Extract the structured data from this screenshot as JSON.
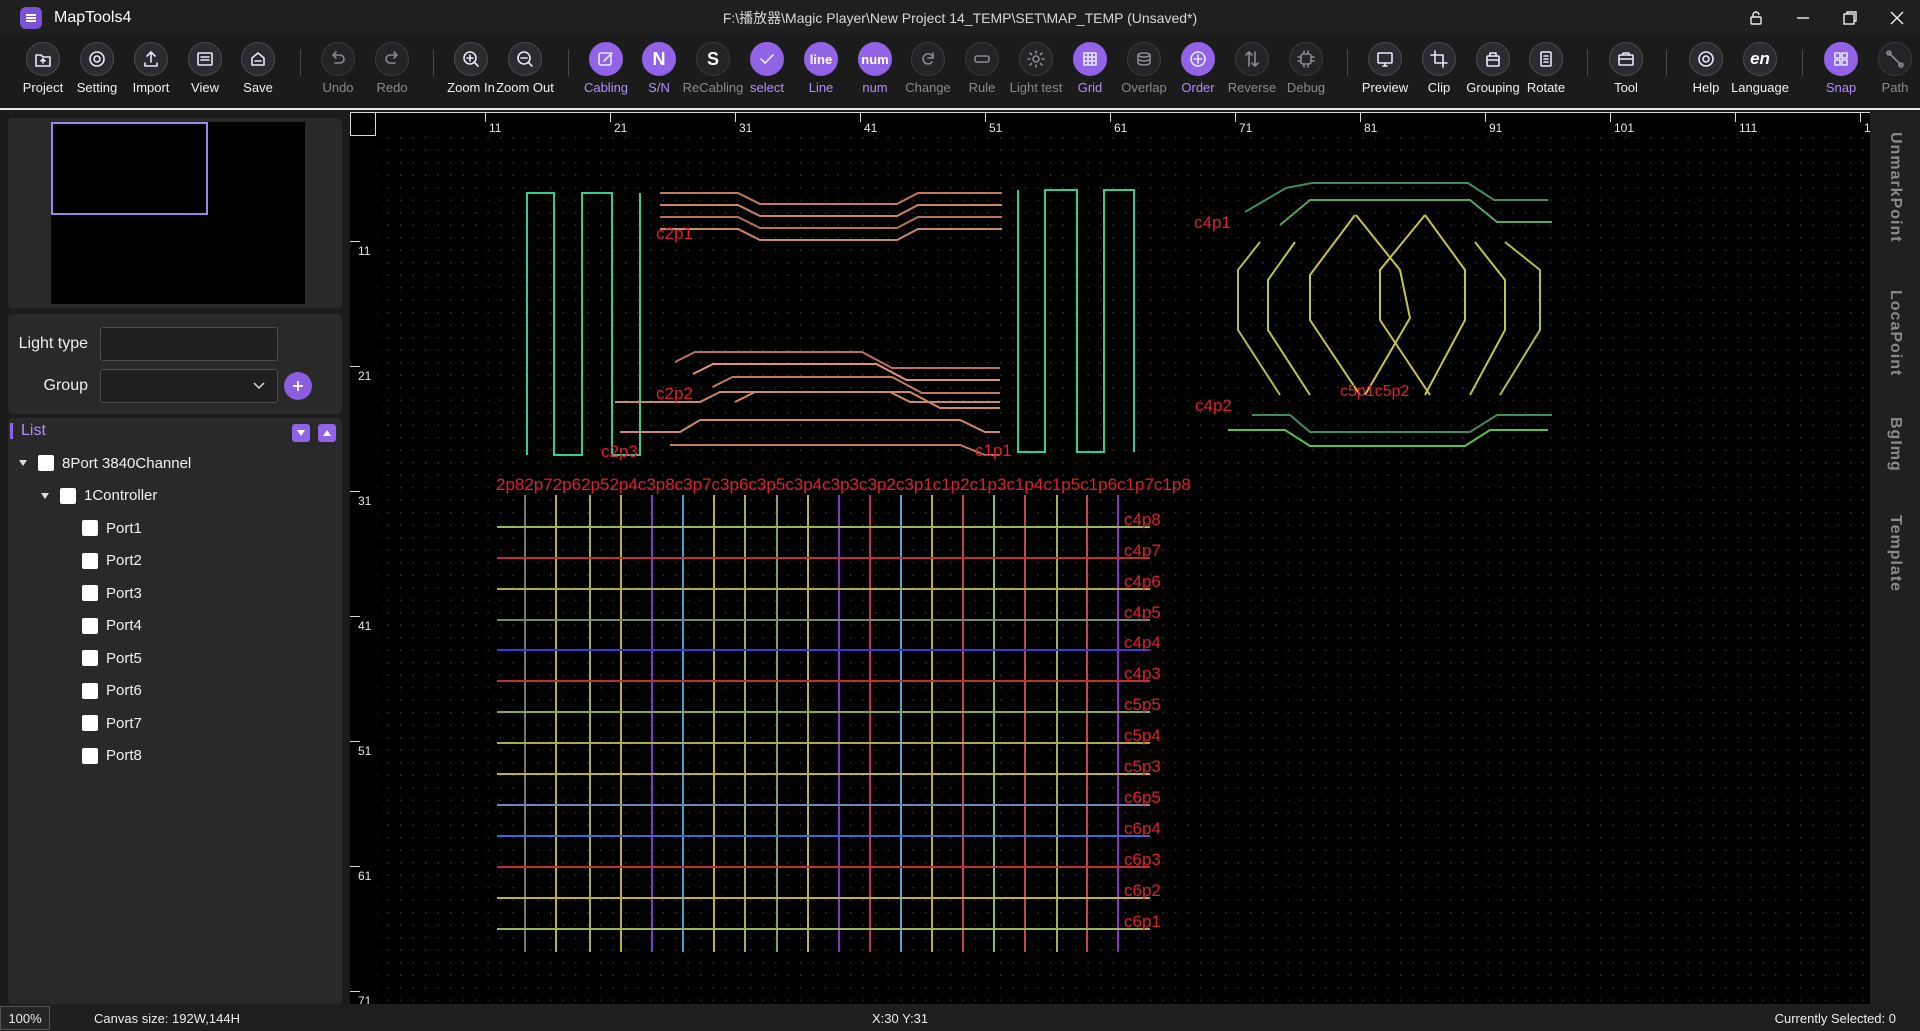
{
  "app": {
    "name": "MapTools4",
    "window_title": "F:\\播放器\\Magic Player\\New Project 14_TEMP\\SET\\MAP_TEMP (Unsaved*)"
  },
  "toolbar": [
    {
      "label": "Project",
      "icon": "folder-icon",
      "state": "normal"
    },
    {
      "label": "Setting",
      "icon": "gear-icon",
      "state": "normal"
    },
    {
      "label": "Import",
      "icon": "upload-icon",
      "state": "normal"
    },
    {
      "label": "View",
      "icon": "view-icon",
      "state": "normal"
    },
    {
      "label": "Save",
      "icon": "save-icon",
      "state": "normal"
    },
    {
      "label": "Undo",
      "icon": "undo-icon",
      "state": "disabled"
    },
    {
      "label": "Redo",
      "icon": "redo-icon",
      "state": "disabled"
    },
    {
      "label": "Zoom In",
      "icon": "zoom-in-icon",
      "state": "normal"
    },
    {
      "label": "Zoom Out",
      "icon": "zoom-out-icon",
      "state": "normal"
    },
    {
      "label": "Cabling",
      "icon": "edit-icon",
      "state": "active"
    },
    {
      "label": "S/N",
      "icon": "sn-icon",
      "text": "N",
      "state": "active"
    },
    {
      "label": "ReCabling",
      "icon": "recabling-icon",
      "text": "S",
      "state": "disabled"
    },
    {
      "label": "select",
      "icon": "check-icon",
      "state": "active"
    },
    {
      "label": "Line",
      "icon": "line-icon",
      "text": "line",
      "state": "active"
    },
    {
      "label": "num",
      "icon": "num-icon",
      "text": "num",
      "state": "active"
    },
    {
      "label": "Change",
      "icon": "refresh-icon",
      "state": "disabled"
    },
    {
      "label": "Rule",
      "icon": "ruler-icon",
      "state": "disabled"
    },
    {
      "label": "Light test",
      "icon": "sun-icon",
      "state": "disabled"
    },
    {
      "label": "Grid",
      "icon": "grid-icon",
      "state": "active"
    },
    {
      "label": "Overlap",
      "icon": "layers-icon",
      "state": "disabled"
    },
    {
      "label": "Order",
      "icon": "order-icon",
      "state": "active"
    },
    {
      "label": "Reverse",
      "icon": "reverse-icon",
      "state": "disabled"
    },
    {
      "label": "Debug",
      "icon": "chip-icon",
      "state": "disabled"
    },
    {
      "label": "Preview",
      "icon": "monitor-icon",
      "state": "normal"
    },
    {
      "label": "Clip",
      "icon": "crop-icon",
      "state": "normal"
    },
    {
      "label": "Grouping",
      "icon": "grouping-icon",
      "state": "normal"
    },
    {
      "label": "Rotate",
      "icon": "rotate-icon",
      "state": "normal"
    },
    {
      "label": "Tool",
      "icon": "toolbox-icon",
      "state": "normal"
    },
    {
      "label": "Help",
      "icon": "lifebuoy-icon",
      "state": "normal"
    },
    {
      "label": "Language",
      "icon": "language-icon",
      "text": "en",
      "state": "normal"
    },
    {
      "label": "Snap",
      "icon": "snap-icon",
      "state": "active"
    },
    {
      "label": "Path",
      "icon": "path-icon",
      "state": "disabled"
    }
  ],
  "properties": {
    "light_type_label": "Light type",
    "light_type_value": "",
    "group_label": "Group",
    "group_value": ""
  },
  "list": {
    "title": "List",
    "tree": [
      {
        "label": "8Port 3840Channel",
        "level": 0,
        "expanded": true
      },
      {
        "label": "1Controller",
        "level": 1,
        "expanded": true
      },
      {
        "label": "Port1",
        "level": 2
      },
      {
        "label": "Port2",
        "level": 2
      },
      {
        "label": "Port3",
        "level": 2
      },
      {
        "label": "Port4",
        "level": 2
      },
      {
        "label": "Port5",
        "level": 2
      },
      {
        "label": "Port6",
        "level": 2
      },
      {
        "label": "Port7",
        "level": 2
      },
      {
        "label": "Port8",
        "level": 2
      }
    ]
  },
  "ruler": {
    "top_labels": [
      "11",
      "21",
      "31",
      "41",
      "51",
      "61",
      "71",
      "81",
      "91",
      "101",
      "111",
      "1"
    ],
    "left_labels": [
      "11",
      "21",
      "31",
      "41",
      "51",
      "61",
      "71"
    ]
  },
  "map_labels": {
    "c2p1": "c2p1",
    "c2p2": "c2p2",
    "c2p3": "c2p3",
    "c1p1": "c1p1",
    "c4p1": "c4p1",
    "c4p2": "c4p2",
    "c5p_c5p2": "c5p1c5p2",
    "grid_top": "2p82p72p62p52p4c3p8c3p7c3p6c3p5c3p4c3p3c3p2c3p1c1p2c1p3c1p4c1p5c1p6c1p7c1p8",
    "grid_right": [
      "c4p8",
      "c4p7",
      "c4p6",
      "c4p5",
      "c4p4",
      "c4p3",
      "c5p5",
      "c5p4",
      "c5p3",
      "c6p5",
      "c6p4",
      "c6p3",
      "c6p2",
      "c6p1"
    ]
  },
  "right_tabs": [
    "UnmarkPoint",
    "LocaPoint",
    "BgImg",
    "Template"
  ],
  "status": {
    "zoom": "100%",
    "canvas_size": "Canvas size:  192W,144H",
    "cursor": "X:30   Y:31",
    "selection": "Currently Selected: 0"
  },
  "colors": {
    "accent": "#9163e6",
    "label_red": "#e0202a"
  }
}
